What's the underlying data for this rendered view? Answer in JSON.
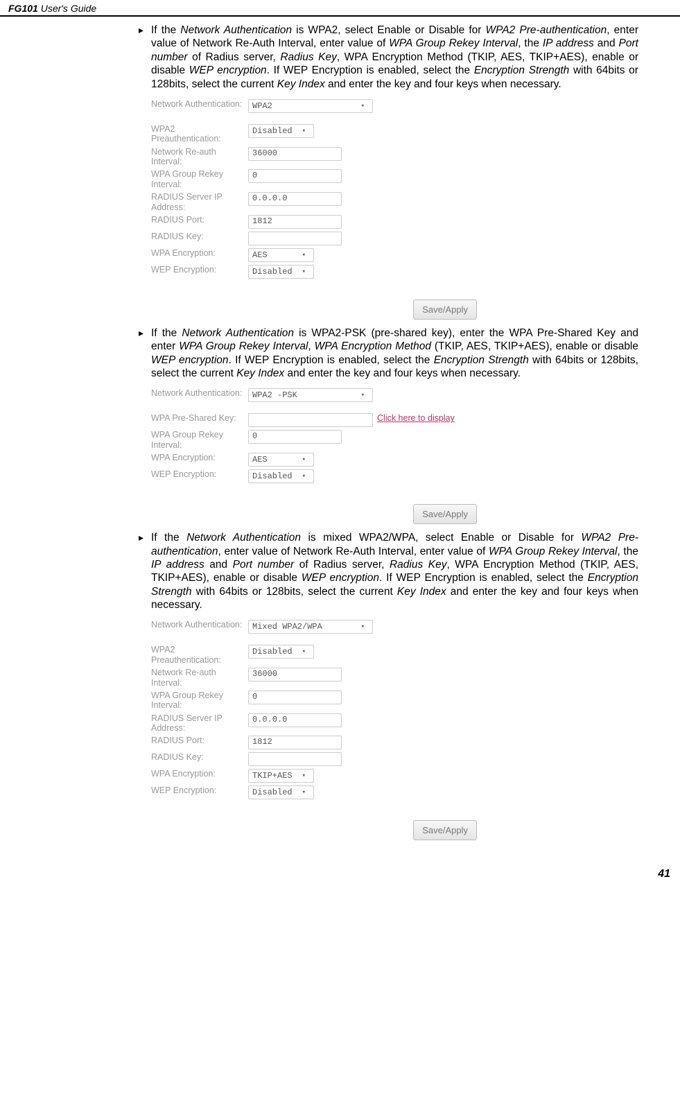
{
  "header": {
    "model": "FG101",
    "guide": " User's Guide"
  },
  "page_number": "41",
  "sections": [
    {
      "text_html": "If the <em>Network Authentication</em> is WPA2, select Enable or Disable for <em>WPA2 Pre-authentication</em>, enter value of Network Re-Auth Interval, enter value of <em>WPA Group Rekey Interval</em>, the <em>IP address</em> and <em>Port number</em> of Radius server, <em>Radius Key</em>, WPA Encryption Method (TKIP, AES, TKIP+AES), enable or disable <em>WEP encryption</em>. If WEP Encryption is enabled, select the <em>Encryption Strength</em> with 64bits or 128bits, select the current <em>Key Index</em> and enter the key and four keys when necessary.",
      "form": {
        "rows": [
          {
            "label": "Network Authentication:",
            "value": "WPA2",
            "type": "select",
            "width": "w-lg"
          },
          {
            "label": "",
            "value": "",
            "type": "spacer"
          },
          {
            "label": "WPA2 Preauthentication:",
            "value": "Disabled",
            "type": "select",
            "width": "w-sm"
          },
          {
            "label": "Network Re-auth Interval:",
            "value": "36000",
            "type": "text",
            "width": "w-md"
          },
          {
            "label": "WPA Group Rekey Interval:",
            "value": "0",
            "type": "text",
            "width": "w-md"
          },
          {
            "label": "RADIUS Server IP Address:",
            "value": "0.0.0.0",
            "type": "text",
            "width": "w-md"
          },
          {
            "label": "RADIUS Port:",
            "value": "1812",
            "type": "text",
            "width": "w-md"
          },
          {
            "label": "RADIUS Key:",
            "value": "",
            "type": "text",
            "width": "w-md"
          },
          {
            "label": "WPA Encryption:",
            "value": "AES",
            "type": "select",
            "width": "w-sm"
          },
          {
            "label": "WEP Encryption:",
            "value": "Disabled",
            "type": "select",
            "width": "w-sm"
          }
        ],
        "button": "Save/Apply"
      }
    },
    {
      "text_html": "If the <em>Network Authentication</em> is WPA2-PSK (pre-shared key), enter the WPA Pre-Shared Key and enter <em>WPA Group Rekey Interval</em>, <em>WPA Encryption Method</em> (TKIP, AES, TKIP+AES), enable or disable <em>WEP encryption</em>. If WEP Encryption is enabled, select the <em>Encryption Strength</em> with 64bits or 128bits, select the current <em>Key Index</em> and enter the key and four keys when necessary.",
      "form": {
        "rows": [
          {
            "label": "Network Authentication:",
            "value": "WPA2 -PSK",
            "type": "select",
            "width": "w-lg"
          },
          {
            "label": "",
            "value": "",
            "type": "spacer"
          },
          {
            "label": "WPA Pre-Shared Key:",
            "value": "",
            "type": "text",
            "width": "w-lg",
            "after": "Click here to display"
          },
          {
            "label": "WPA Group Rekey Interval:",
            "value": "0",
            "type": "text",
            "width": "w-md"
          },
          {
            "label": "WPA Encryption:",
            "value": "AES",
            "type": "select",
            "width": "w-sm"
          },
          {
            "label": "WEP Encryption:",
            "value": "Disabled",
            "type": "select",
            "width": "w-sm"
          }
        ],
        "button": "Save/Apply"
      }
    },
    {
      "text_html": "If the <em>Network Authentication</em> is mixed WPA2/WPA, select Enable or Disable for <em>WPA2 Pre-authentication</em>, enter value of Network Re-Auth Interval, enter value of <em>WPA Group Rekey Interval</em>, the <em>IP address</em> and <em>Port number</em> of Radius server, <em>Radius Key</em>, WPA Encryption Method (TKIP, AES, TKIP+AES), enable or disable <em>WEP encryption</em>. If WEP Encryption is enabled, select the <em>Encryption Strength</em> with 64bits or 128bits, select the current <em>Key Index</em> and enter the key and four keys when necessary.",
      "form": {
        "rows": [
          {
            "label": "Network Authentication:",
            "value": "Mixed WPA2/WPA",
            "type": "select",
            "width": "w-lg"
          },
          {
            "label": "",
            "value": "",
            "type": "spacer"
          },
          {
            "label": "WPA2 Preauthentication:",
            "value": "Disabled",
            "type": "select",
            "width": "w-sm"
          },
          {
            "label": "Network Re-auth Interval:",
            "value": "36000",
            "type": "text",
            "width": "w-md"
          },
          {
            "label": "WPA Group Rekey Interval:",
            "value": "0",
            "type": "text",
            "width": "w-md"
          },
          {
            "label": "RADIUS Server IP Address:",
            "value": "0.0.0.0",
            "type": "text",
            "width": "w-md"
          },
          {
            "label": "RADIUS Port:",
            "value": "1812",
            "type": "text",
            "width": "w-md"
          },
          {
            "label": "RADIUS Key:",
            "value": "",
            "type": "text",
            "width": "w-md"
          },
          {
            "label": "WPA Encryption:",
            "value": "TKIP+AES",
            "type": "select",
            "width": "w-sm"
          },
          {
            "label": "WEP Encryption:",
            "value": "Disabled",
            "type": "select",
            "width": "w-sm"
          }
        ],
        "button": "Save/Apply"
      }
    }
  ]
}
